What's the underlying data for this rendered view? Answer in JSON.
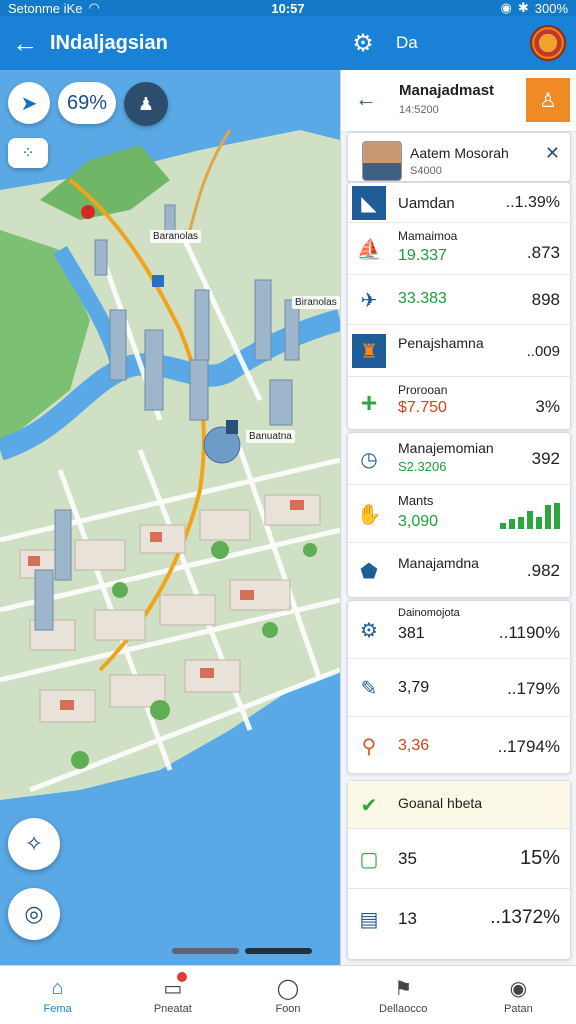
{
  "status_bar": {
    "carrier": "Setonme iKe",
    "time": "10:57",
    "battery": "300%"
  },
  "app_bar": {
    "title": "INdaljagsian",
    "right_title": "Da"
  },
  "map": {
    "zoom_text": "69%",
    "labels": [
      "Baranolas",
      "Biranolas",
      "Banuatna"
    ]
  },
  "panel": {
    "header_title": "Manajadmast",
    "header_sub": "14:5200",
    "profile": {
      "name": "Aatem Mosorah",
      "id": "S4000"
    },
    "card1": [
      {
        "icon": "chart-icon",
        "label": "Uamdan",
        "right": "..1.39%"
      },
      {
        "icon": "boat-icon",
        "label": "Mamaimoa",
        "value": "19.337",
        "right": ".873"
      },
      {
        "icon": "money-icon",
        "label": "",
        "value": "33.383",
        "right": "898"
      },
      {
        "icon": "building-icon",
        "label": "Penajshamna",
        "value": "",
        "right": "..009"
      },
      {
        "icon": "plus-icon",
        "label": "Prorooan",
        "value": "$7.750",
        "right": "3%"
      }
    ],
    "card2": [
      {
        "icon": "clock-icon",
        "label": "Manajemomian",
        "value": "S2.3206",
        "right": "392"
      },
      {
        "icon": "hands-icon",
        "label": "Mants",
        "value": "3,090",
        "right": ""
      },
      {
        "icon": "heart-icon",
        "label": "Manajamdna",
        "value": "",
        "right": ".982"
      }
    ],
    "card3": [
      {
        "icon": "gear-icon",
        "label": "Dainomojota",
        "value": "381",
        "right": "..1190%"
      },
      {
        "icon": "pen-icon",
        "label": "",
        "value": "3,79",
        "right": "..179%"
      },
      {
        "icon": "search-icon",
        "label": "",
        "value": "3,36",
        "right": "..1794%"
      }
    ],
    "card4": {
      "title": "Goanal hbeta",
      "rows": [
        {
          "icon": "chat-icon",
          "value": "35",
          "right": "15%"
        },
        {
          "icon": "document-icon",
          "value": "13",
          "right": "..1372%"
        }
      ]
    }
  },
  "bottom_nav": [
    {
      "icon": "home-icon",
      "label": "Fema"
    },
    {
      "icon": "badge-icon",
      "label": "Pneatat"
    },
    {
      "icon": "user-icon",
      "label": "Foon"
    },
    {
      "icon": "flag-icon",
      "label": "Dellaocco"
    },
    {
      "icon": "person-icon",
      "label": "Patan"
    }
  ],
  "colors": {
    "primary": "#1a82d6",
    "accent": "#f08a24",
    "positive": "#1e9e3a",
    "warning": "#e07b14"
  }
}
